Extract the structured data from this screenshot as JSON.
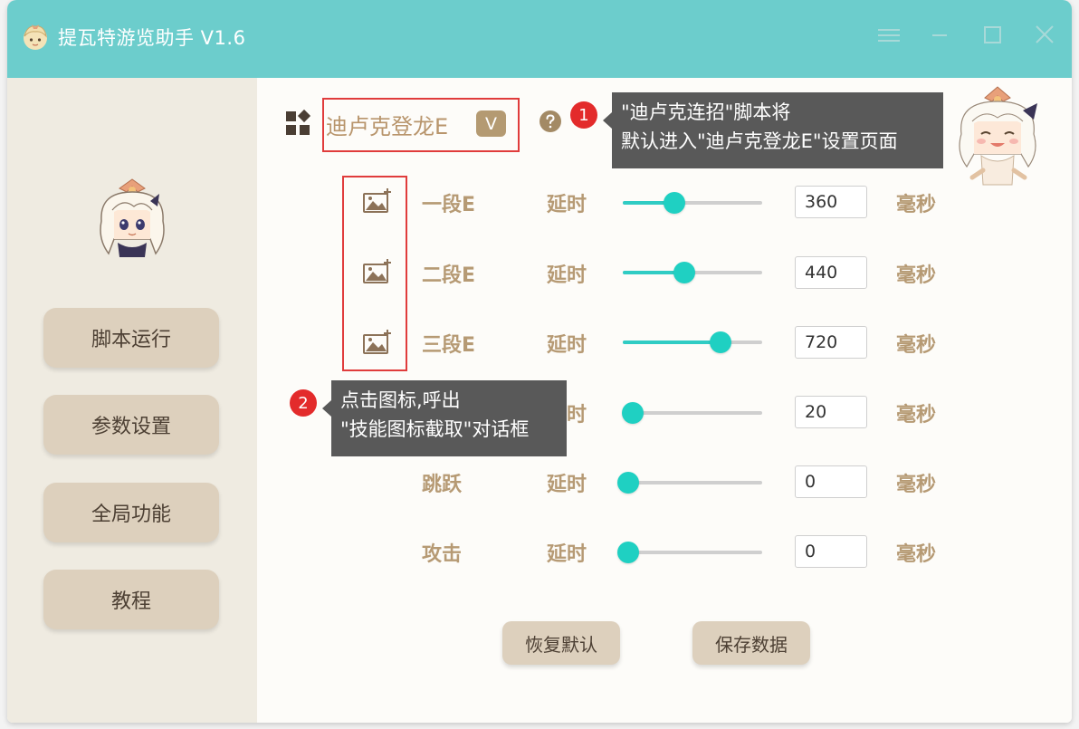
{
  "app": {
    "title": "提瓦特游览助手 V1.6"
  },
  "sidebar": {
    "items": [
      {
        "label": "脚本运行"
      },
      {
        "label": "参数设置"
      },
      {
        "label": "全局功能"
      },
      {
        "label": "教程"
      }
    ]
  },
  "header": {
    "title": "迪卢克登龙E",
    "version_badge": "V"
  },
  "annotations": [
    {
      "number": "1",
      "line1": "\"迪卢克连招\"脚本将",
      "line2": "默认进入\"迪卢克登龙E\"设置页面"
    },
    {
      "number": "2",
      "line1": "点击图标,呼出",
      "line2": "\"技能图标截取\"对话框"
    }
  ],
  "rows": [
    {
      "label": "一段E",
      "delay_label": "延时",
      "value": "360",
      "unit": "毫秒",
      "slider_pct": 37
    },
    {
      "label": "二段E",
      "delay_label": "延时",
      "value": "440",
      "unit": "毫秒",
      "slider_pct": 44
    },
    {
      "label": "三段E",
      "delay_label": "延时",
      "value": "720",
      "unit": "毫秒",
      "slider_pct": 70
    },
    {
      "label": "",
      "delay_label": "延时",
      "value": "20",
      "unit": "毫秒",
      "slider_pct": 7
    },
    {
      "label": "跳跃",
      "delay_label": "延时",
      "value": "0",
      "unit": "毫秒",
      "slider_pct": 4
    },
    {
      "label": "攻击",
      "delay_label": "延时",
      "value": "0",
      "unit": "毫秒",
      "slider_pct": 4
    }
  ],
  "actions": {
    "reset_label": "恢复默认",
    "save_label": "保存数据"
  },
  "colors": {
    "titlebar": "#6ccdcc",
    "sidebar": "#efebe1",
    "button": "#ddd0bd",
    "accent_text": "#b69a74",
    "slider": "#1fd0c2",
    "annotation": "#e32b2b"
  }
}
